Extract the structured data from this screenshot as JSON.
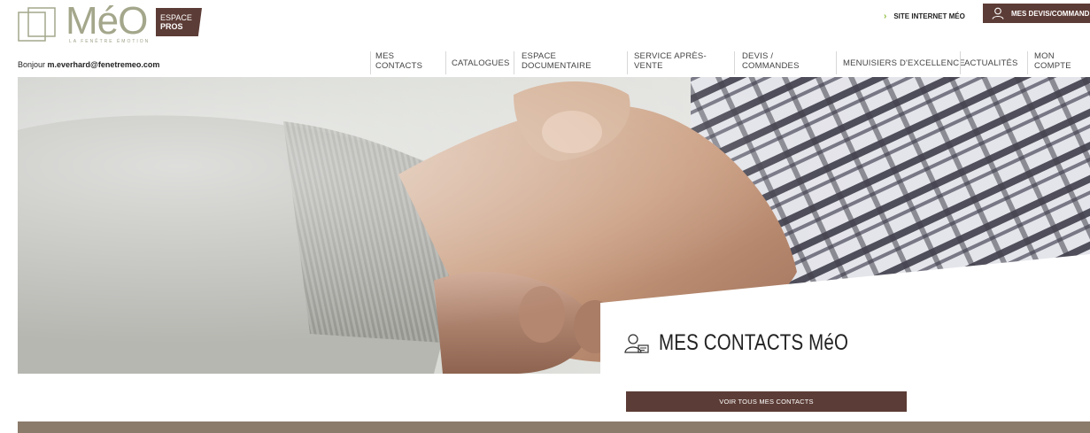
{
  "brand": {
    "logo_text": "MéO",
    "tagline": "LA FENÊTRE ÉMOTION",
    "badge_line1": "ESPACE",
    "badge_line2": "PROS",
    "accent_color": "#5c3c36",
    "logo_color": "#a4a78b"
  },
  "top_links": {
    "site": "SITE INTERNET MÉO",
    "site_icon": "chevron-right-icon",
    "devis": "MES DEVIS/COMMANDES",
    "devis_icon": "user-icon"
  },
  "greeting": {
    "prefix": "Bonjour ",
    "email": "m.everhard@fenetremeo.com"
  },
  "nav": {
    "items": [
      {
        "label": "MES CONTACTS"
      },
      {
        "label": "CATALOGUES"
      },
      {
        "label": "ESPACE DOCUMENTAIRE"
      },
      {
        "label": "SERVICE APRÈS-VENTE"
      },
      {
        "label": "DEVIS / COMMANDES"
      },
      {
        "label": "MENUISIERS D'EXCELLENCE"
      },
      {
        "label": "ACTUALITÉS"
      },
      {
        "label": "MON COMPTE"
      }
    ]
  },
  "hero": {
    "image": "handshake-photo",
    "title": "MES CONTACTS MéO",
    "title_icon": "contact-person-icon",
    "cta_label": "VOIR TOUS MES CONTACTS"
  }
}
